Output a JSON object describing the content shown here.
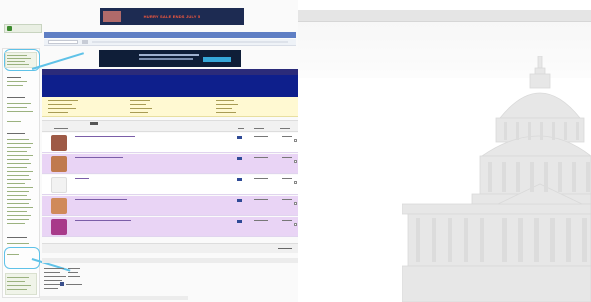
{
  "thumbnail": {
    "ad_banner": {
      "text": "HURRY SALE ENDS JULY 5"
    }
  },
  "viewer": {
    "background_icon": "capitol-dome-icon"
  },
  "colors": {
    "nav_blue": "#5f7fc4",
    "header_navy": "#2b2b7a",
    "panel_blue": "#0e1f8c",
    "info_yellow": "#fff9d2",
    "row_purple": "#e9d4f5",
    "highlight_cyan": "#5fc2e8"
  }
}
